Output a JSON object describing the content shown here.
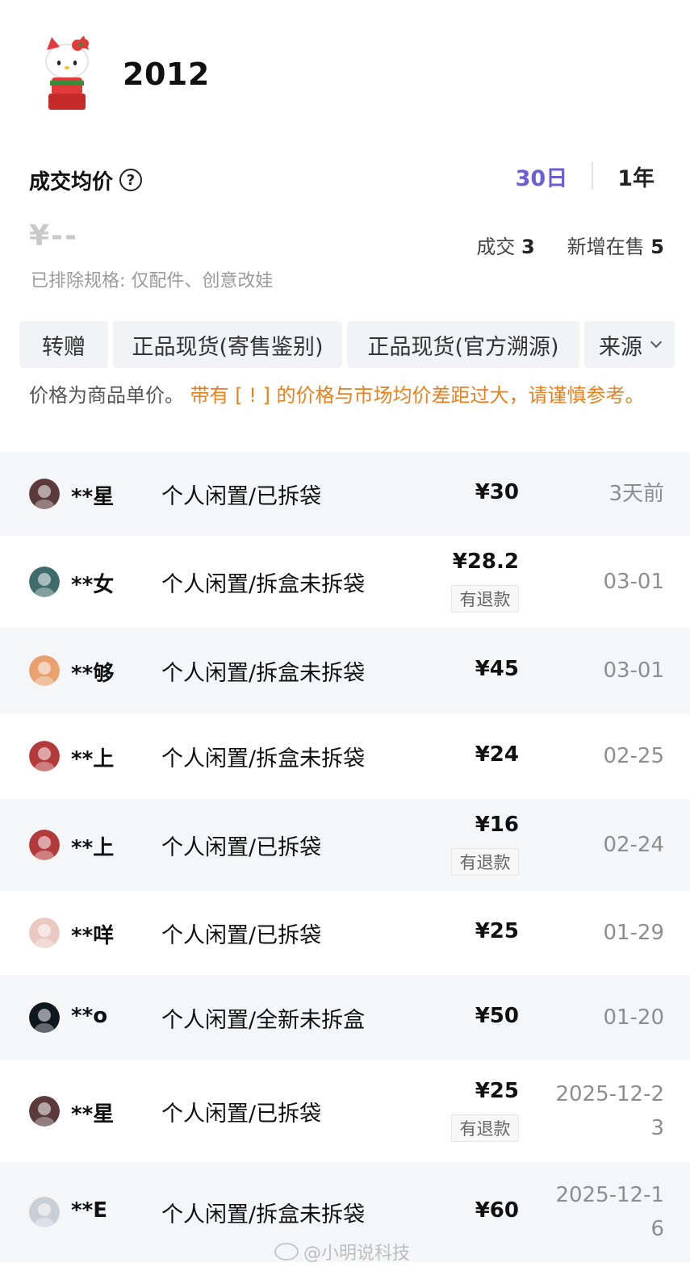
{
  "product": {
    "title": "2012",
    "thumbnail_icon": "hello-kitty-figure-icon"
  },
  "avg_price": {
    "title": "成交均价",
    "help_icon": "?",
    "value": "¥--",
    "excluded_note": "已排除规格: 仅配件、创意改娃"
  },
  "range_tabs": [
    {
      "label": "30日",
      "active": true
    },
    {
      "label": "1年",
      "active": false
    }
  ],
  "stats": {
    "deals_label": "成交",
    "deals_value": "3",
    "new_listings_label": "新增在售",
    "new_listings_value": "5"
  },
  "filters": [
    "转赠",
    "正品现货(寄售鉴别)",
    "正品现货(官方溯源)",
    "来源"
  ],
  "notice": {
    "text": "价格为商品单价。",
    "warning": "带有 [ ! ] 的价格与市场均价差距过大，请谨慎参考。"
  },
  "transactions": [
    {
      "user": "**星",
      "condition": "个人闲置/已拆袋",
      "price": "¥30",
      "refund": "",
      "date": "3天前",
      "avatar_color": "#5a3a3a"
    },
    {
      "user": "**女",
      "condition": "个人闲置/拆盒未拆袋",
      "price": "¥28.2",
      "refund": "有退款",
      "date": "03-01",
      "avatar_color": "#3f6b6b"
    },
    {
      "user": "**够",
      "condition": "个人闲置/拆盒未拆袋",
      "price": "¥45",
      "refund": "",
      "date": "03-01",
      "avatar_color": "#e8a06f"
    },
    {
      "user": "**上",
      "condition": "个人闲置/拆盒未拆袋",
      "price": "¥24",
      "refund": "",
      "date": "02-25",
      "avatar_color": "#b33a3a"
    },
    {
      "user": "**上",
      "condition": "个人闲置/已拆袋",
      "price": "¥16",
      "refund": "有退款",
      "date": "02-24",
      "avatar_color": "#b33a3a"
    },
    {
      "user": "**咩",
      "condition": "个人闲置/已拆袋",
      "price": "¥25",
      "refund": "",
      "date": "01-29",
      "avatar_color": "#e9c9c0"
    },
    {
      "user": "**o",
      "condition": "个人闲置/全新未拆盒",
      "price": "¥50",
      "refund": "",
      "date": "01-20",
      "avatar_color": "#10181f"
    },
    {
      "user": "**星",
      "condition": "个人闲置/已拆袋",
      "price": "¥25",
      "refund": "有退款",
      "date": "2025-12-23",
      "avatar_color": "#5a3a3a"
    },
    {
      "user": "**E",
      "condition": "个人闲置/拆盒未拆袋",
      "price": "¥60",
      "refund": "",
      "date": "2025-12-16",
      "avatar_color": "#c9cfd6"
    }
  ],
  "watermark": "@小明说科技"
}
